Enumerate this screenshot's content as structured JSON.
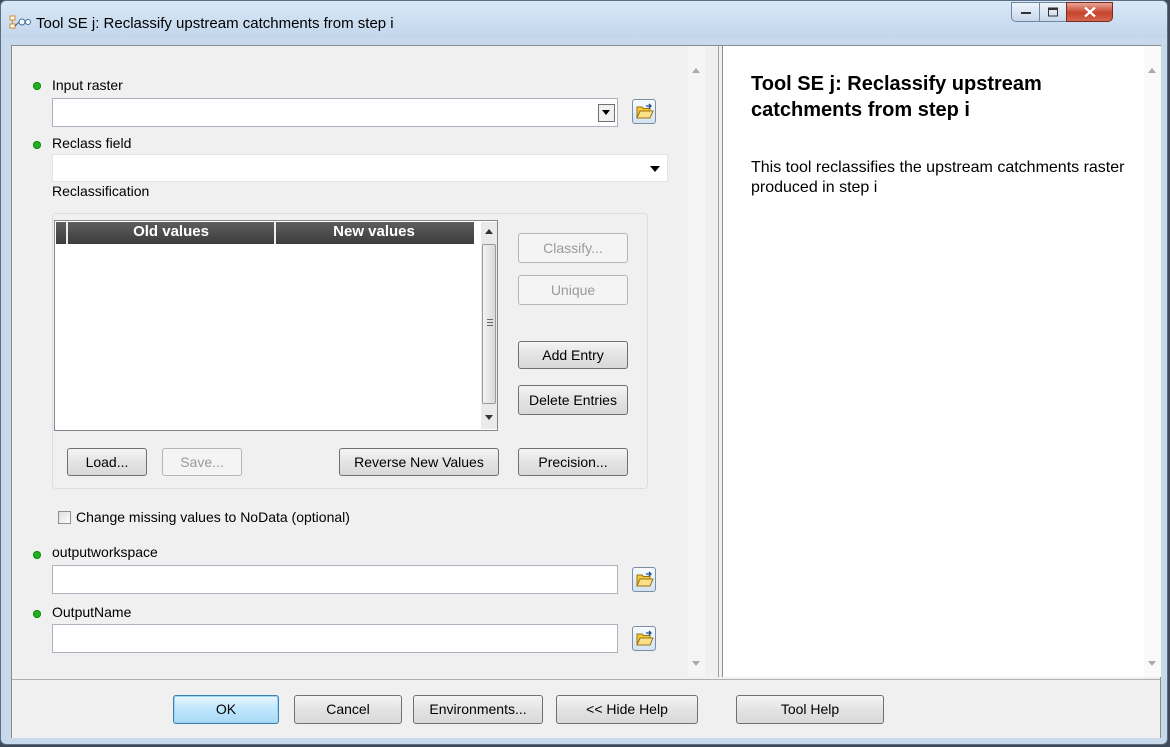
{
  "window": {
    "title": "Tool SE j: Reclassify upstream catchments from step i"
  },
  "form": {
    "input_raster": {
      "label": "Input raster",
      "value": ""
    },
    "reclass_field": {
      "label": "Reclass field",
      "value": ""
    },
    "reclassification": {
      "label": "Reclassification",
      "columns": [
        "Old values",
        "New values"
      ],
      "rows": [],
      "buttons": {
        "classify": "Classify...",
        "unique": "Unique",
        "add_entry": "Add Entry",
        "delete_entries": "Delete Entries",
        "load": "Load...",
        "save": "Save...",
        "reverse": "Reverse New Values",
        "precision": "Precision..."
      }
    },
    "change_missing": {
      "label": "Change missing values to NoData (optional)",
      "checked": false
    },
    "outputworkspace": {
      "label": "outputworkspace",
      "value": ""
    },
    "outputname": {
      "label": "OutputName",
      "value": ""
    }
  },
  "help": {
    "title": "Tool SE j: Reclassify upstream catchments from step i",
    "body": "This tool reclassifies the upstream catchments raster produced in step i"
  },
  "footer": {
    "ok": "OK",
    "cancel": "Cancel",
    "environments": "Environments...",
    "hide_help": "<< Hide Help",
    "tool_help": "Tool Help"
  },
  "colors": {
    "required_dot": "#22b022",
    "title_bar": "#c8d9ec",
    "close_button": "#c7432b",
    "table_header": "#4a4a4a"
  }
}
